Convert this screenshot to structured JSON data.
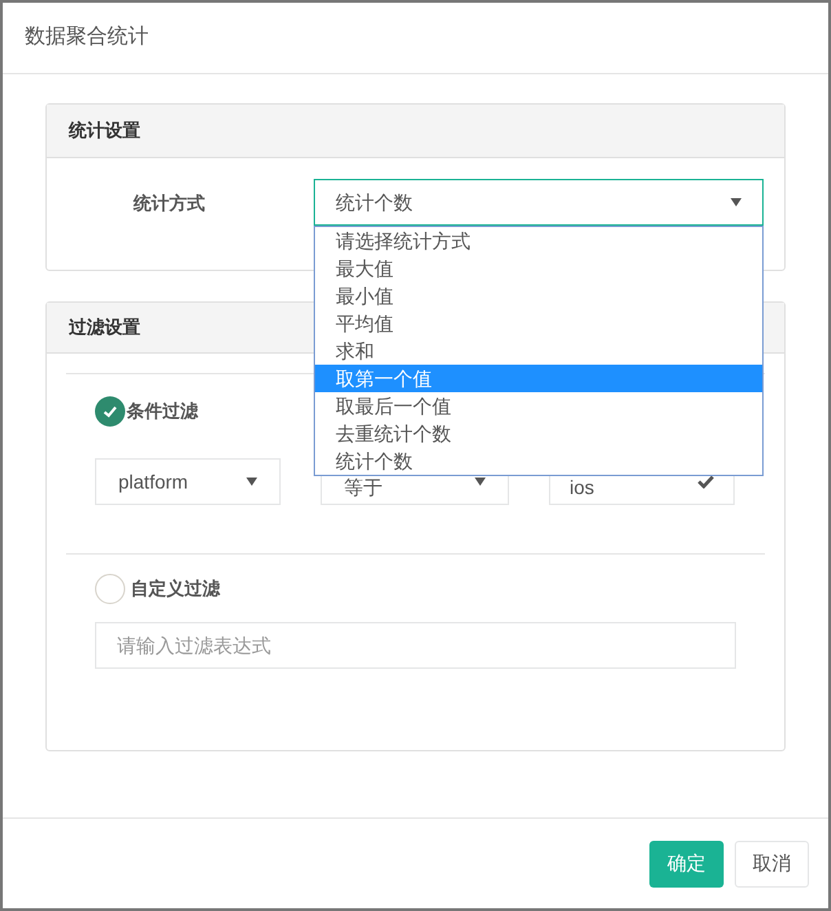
{
  "dialog": {
    "title": "数据聚合统计"
  },
  "stat_panel": {
    "title": "统计设置",
    "label": "统计方式",
    "select": {
      "value": "统计个数",
      "expanded": true
    },
    "options": [
      {
        "label": "请选择统计方式",
        "selected": false
      },
      {
        "label": "最大值",
        "selected": false
      },
      {
        "label": "最小值",
        "selected": false
      },
      {
        "label": "平均值",
        "selected": false
      },
      {
        "label": "求和",
        "selected": false
      },
      {
        "label": "取第一个值",
        "selected": true
      },
      {
        "label": "取最后一个值",
        "selected": false
      },
      {
        "label": "去重统计个数",
        "selected": false
      },
      {
        "label": "统计个数",
        "selected": false
      }
    ]
  },
  "filter_panel": {
    "title": "过滤设置",
    "condition": {
      "label": "条件过滤",
      "selected": true,
      "field": "platform",
      "operator": "等于",
      "value": "ios"
    },
    "custom": {
      "label": "自定义过滤",
      "selected": false,
      "placeholder": "请输入过滤表达式"
    }
  },
  "buttons": [
    {
      "label": "确定",
      "kind": "primary"
    },
    {
      "label": "取消",
      "kind": "default"
    }
  ]
}
